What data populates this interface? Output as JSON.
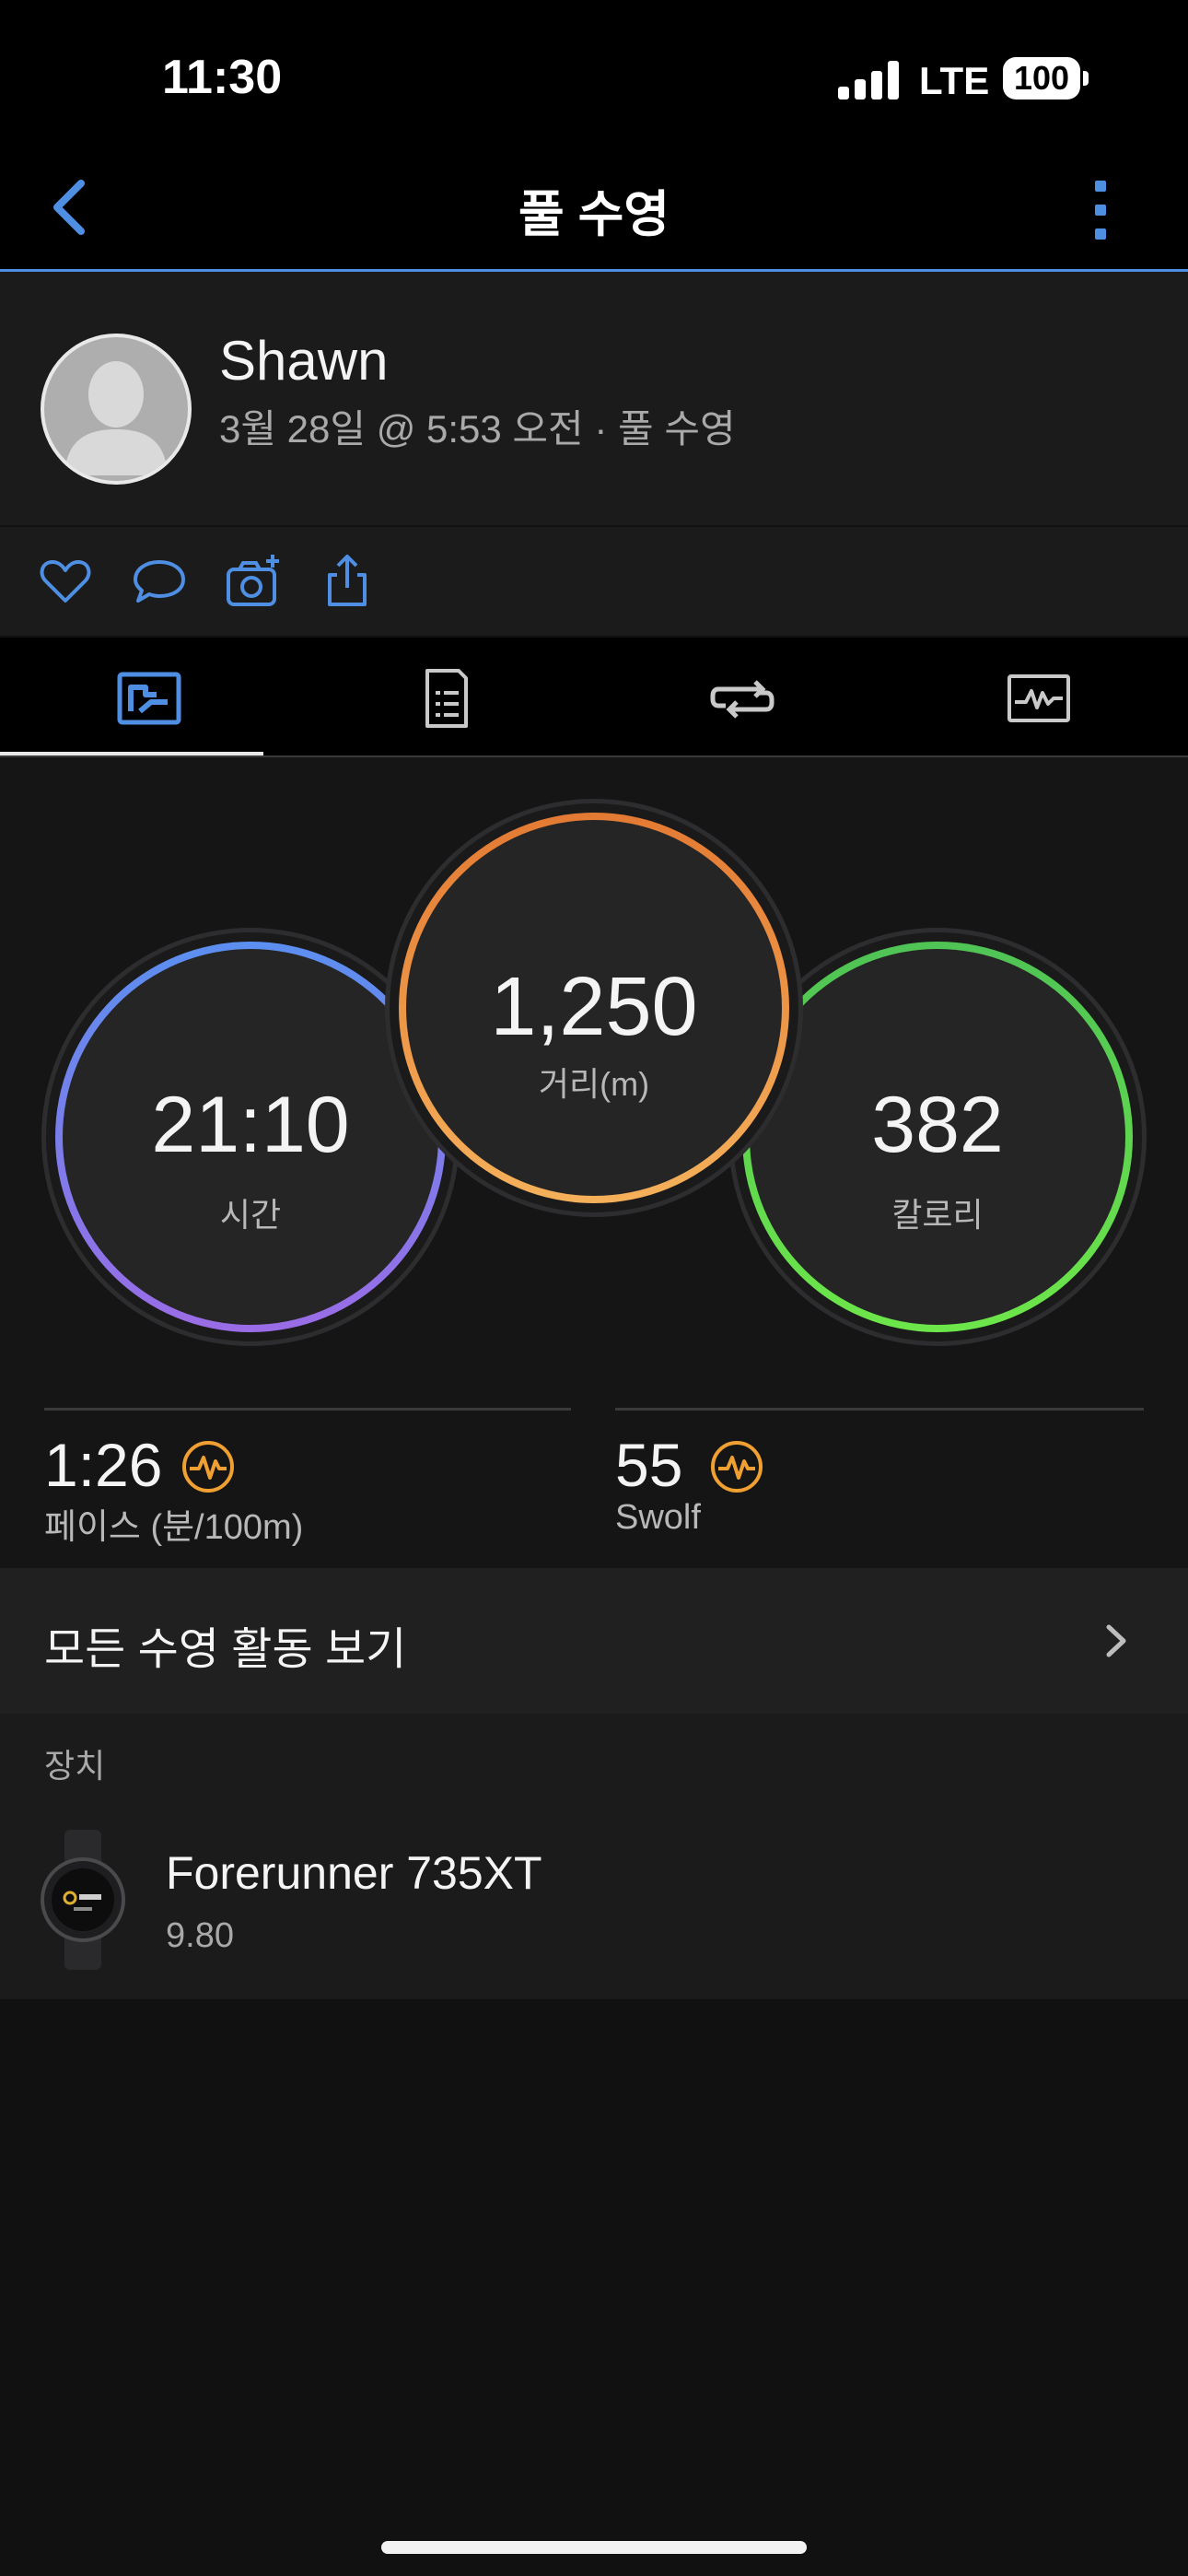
{
  "status_bar": {
    "time": "11:30",
    "network": "LTE",
    "battery": "100"
  },
  "nav": {
    "title": "풀 수영"
  },
  "user": {
    "name": "Shawn",
    "meta": "3월 28일 @ 5:53 오전 · 풀 수영"
  },
  "stats": {
    "time": {
      "value": "21:10",
      "label": "시간"
    },
    "distance": {
      "value": "1,250",
      "label": "거리(m)"
    },
    "calories": {
      "value": "382",
      "label": "칼로리"
    }
  },
  "metrics": [
    {
      "value": "1:26",
      "label": "페이스 (분/100m)"
    },
    {
      "value": "55",
      "label": "Swolf"
    }
  ],
  "all_swims": {
    "label": "모든 수영 활동 보기"
  },
  "device": {
    "header": "장치",
    "name": "Forerunner 735XT",
    "version": "9.80"
  },
  "colors": {
    "accent": "#4f8fe3",
    "time_ring": "#6a7ff0",
    "distance_ring": "#eb8f45",
    "calories_ring": "#5ad44f",
    "metric_icon": "#f0a030"
  }
}
